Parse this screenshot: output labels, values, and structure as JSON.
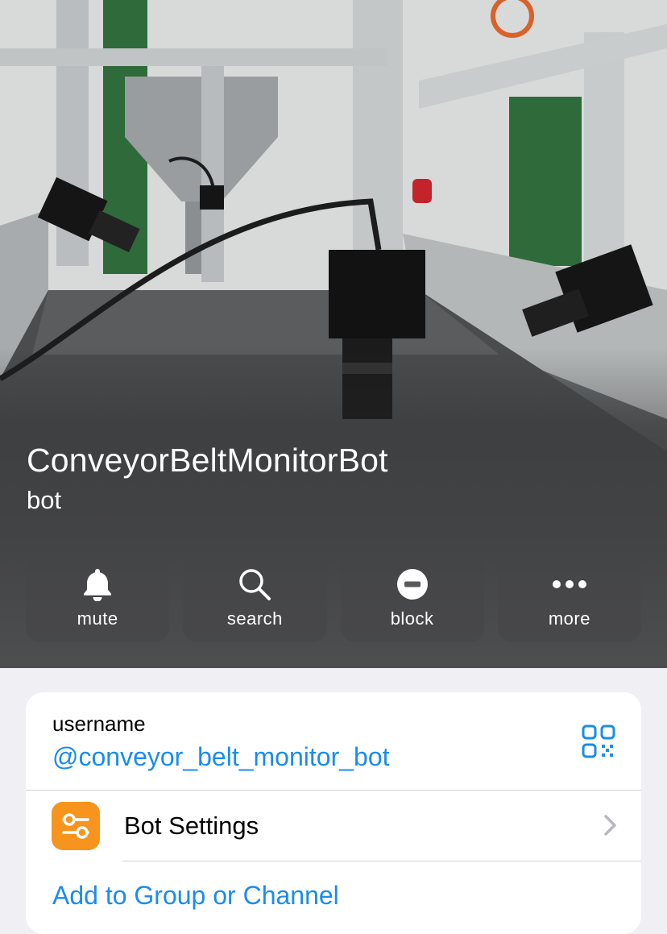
{
  "profile": {
    "name": "ConveyorBeltMonitorBot",
    "subtitle": "bot"
  },
  "actions": [
    {
      "label": "mute",
      "icon": "bell-icon"
    },
    {
      "label": "search",
      "icon": "search-icon"
    },
    {
      "label": "block",
      "icon": "block-icon"
    },
    {
      "label": "more",
      "icon": "more-icon"
    }
  ],
  "info": {
    "username_label": "username",
    "username_value": "@conveyor_belt_monitor_bot",
    "qr_icon": "qr-code-icon"
  },
  "bot_settings": {
    "label": "Bot Settings",
    "icon": "sliders-icon",
    "icon_color": "#f7941d"
  },
  "add_to_group": {
    "label": "Add to Group or Channel"
  },
  "colors": {
    "accent": "#1a8cf0",
    "background": "#efeff4"
  }
}
